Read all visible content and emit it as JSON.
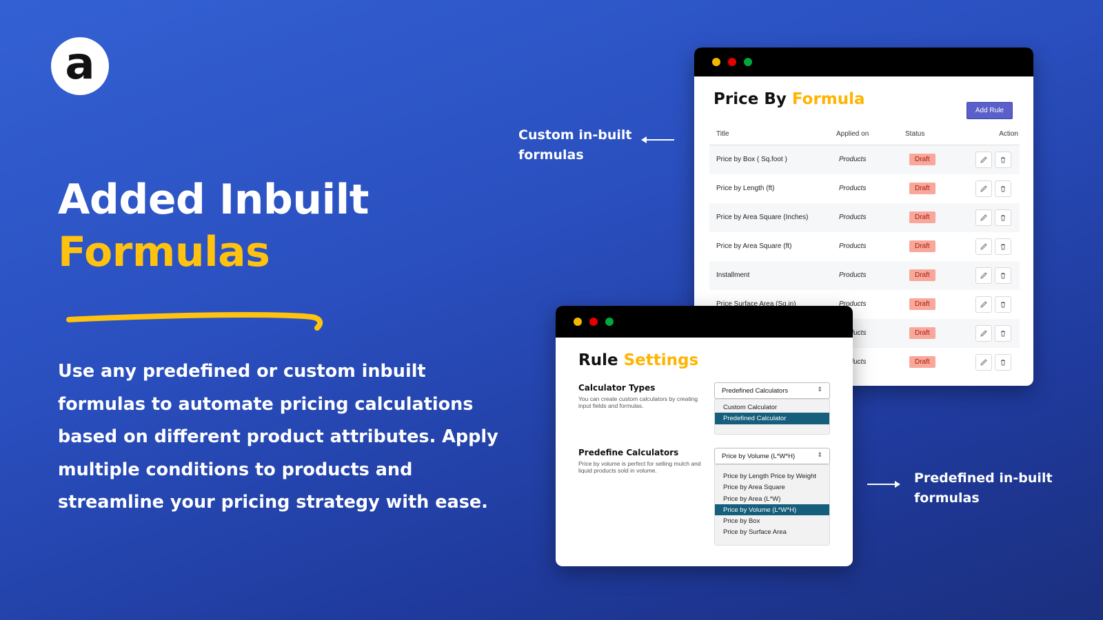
{
  "logo": {
    "letter": "a"
  },
  "headline": {
    "line1": "Added Inbuilt",
    "line2": "Formulas"
  },
  "description": "Use any predefined or custom inbuilt formulas to automate pricing calculations based on different product attributes. Apply multiple conditions to products and streamline your pricing strategy with ease.",
  "callouts": {
    "custom": "Custom in-built formulas",
    "predefined": "Predefined in-built formulas"
  },
  "price_window": {
    "title_main": "Price By ",
    "title_accent": "Formula",
    "add_button": "Add Rule",
    "columns": [
      "Title",
      "Applied on",
      "Status",
      "Action"
    ],
    "rows": [
      {
        "title": "Price by Box ( Sq.foot )",
        "applied": "Products",
        "status": "Draft"
      },
      {
        "title": "Price by Length (ft)",
        "applied": "Products",
        "status": "Draft"
      },
      {
        "title": "Price by Area Square (Inches)",
        "applied": "Products",
        "status": "Draft"
      },
      {
        "title": "Price by Area Square (ft)",
        "applied": "Products",
        "status": "Draft"
      },
      {
        "title": "Installment",
        "applied": "Products",
        "status": "Draft"
      },
      {
        "title": "Price Surface Area (Sq.in)",
        "applied": "Products",
        "status": "Draft"
      },
      {
        "title": "",
        "applied": "Products",
        "status": "Draft"
      },
      {
        "title": "",
        "applied": "Products",
        "status": "Draft"
      }
    ]
  },
  "rule_window": {
    "title_main": "Rule ",
    "title_accent": "Settings",
    "calc_types": {
      "title": "Calculator Types",
      "desc": "You can create custom calculators by creating input fields and formulas.",
      "selected": "Predefined Calculators",
      "options": [
        "Custom Calculator",
        "Predefined Calculator"
      ],
      "selected_option": "Predefined Calculator"
    },
    "predefine": {
      "title": "Predefine Calculators",
      "desc": "Price by volume is perfect for selling mulch and liquid products sold in volume.",
      "selected": "Price by Volume (L*W*H)",
      "options": [
        "Price by Length Price by Weight",
        "Price by Area Square",
        "Price by Area (L*W)",
        "Price by Volume (L*W*H)",
        "Price by Box",
        "Price by Surface Area"
      ],
      "selected_option": "Price by Volume (L*W*H)"
    }
  },
  "colors": {
    "accent": "#ffc20e",
    "button": "#5a5fc9",
    "draft": "#f9a79a",
    "selected": "#155e7c"
  }
}
